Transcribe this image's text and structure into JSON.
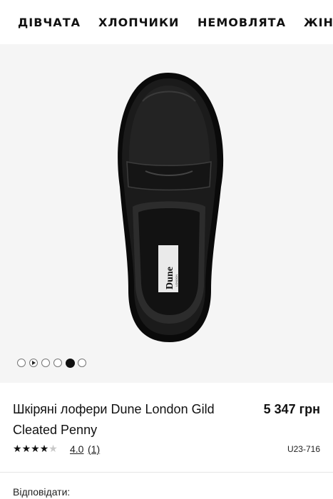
{
  "nav": {
    "items": [
      "ДІВЧАТА",
      "ХЛОПЧИКИ",
      "НЕМОВЛЯТА",
      "ЖІНКИ"
    ]
  },
  "gallery": {
    "slide_count": 6,
    "active_index": 4,
    "video_index": 1,
    "shoe_label_text": "Dune",
    "shoe_label_sub": "LONDON"
  },
  "product": {
    "title_prefix": "Шкіряні лофери",
    "title_brand": "Dune London Gild",
    "title_line2": "Cleated Penny",
    "price": "5 347 грн",
    "rating_value": "4.0",
    "rating_count": "(1)",
    "stars_filled": 4,
    "stars_total": 5,
    "sku": "U23-716"
  },
  "reviews": {
    "reply_label": "Відповідати:"
  },
  "colors": {
    "background": "#ffffff",
    "gallery_bg": "#f5f5f5",
    "text": "#111111",
    "star_empty": "#c8c8c8"
  }
}
